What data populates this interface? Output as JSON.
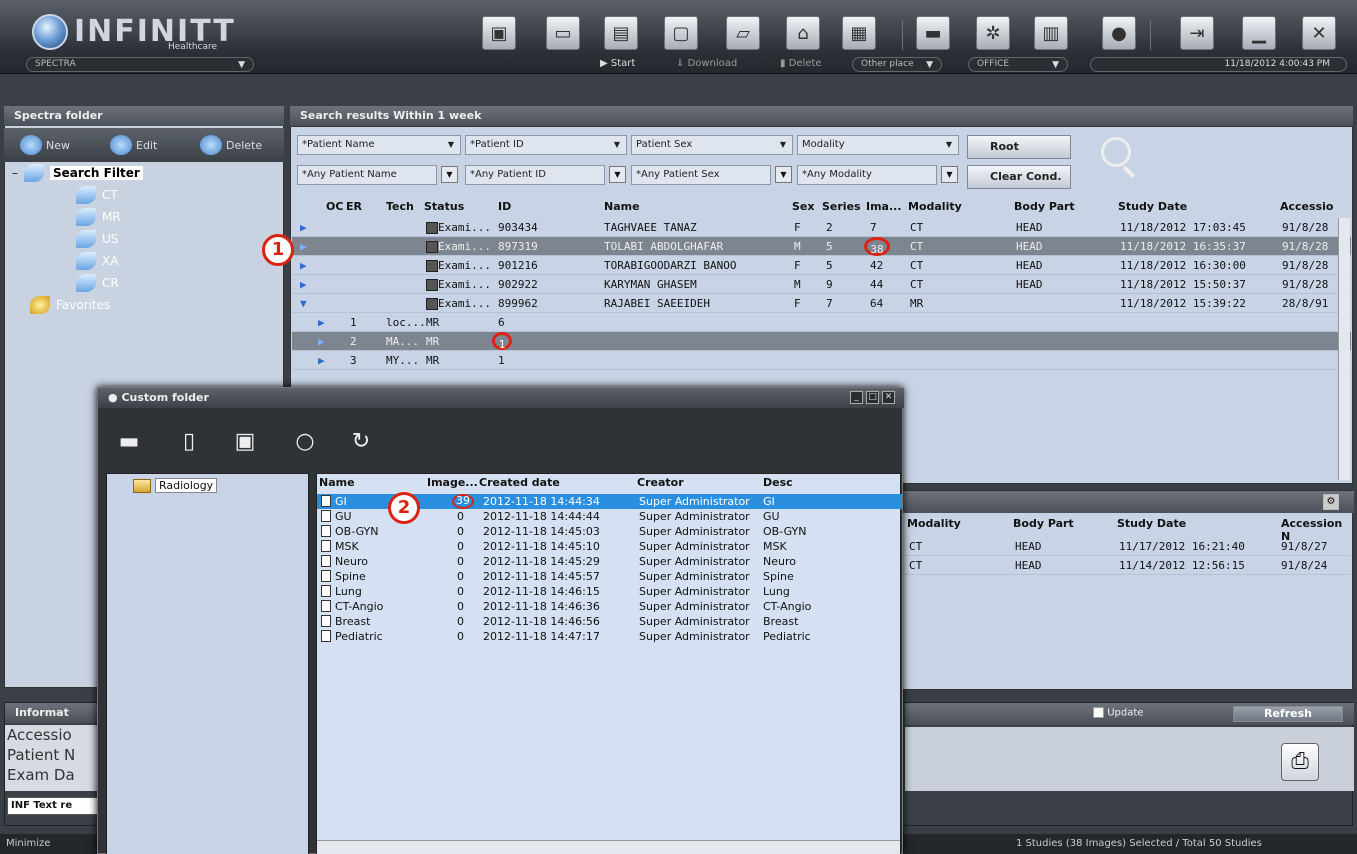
{
  "app": {
    "brand": "INFINITT",
    "brand_sub": "Healthcare",
    "mode": "SPECTRA"
  },
  "toolbar": {
    "start": "Start",
    "download": "Download",
    "delete": "Delete",
    "place": "Other place",
    "office": "OFFICE",
    "clock": "11/18/2012 4:00:43 PM"
  },
  "left": {
    "title": "Spectra folder",
    "new": "New",
    "edit": "Edit",
    "delete": "Delete",
    "root": "Search Filter",
    "items": [
      "CT",
      "MR",
      "US",
      "XA",
      "CR"
    ],
    "favorites": "Favorites"
  },
  "results": {
    "title": "Search results  Within 1 week",
    "filters": [
      {
        "label": "*Patient Name",
        "value": "*Any Patient Name"
      },
      {
        "label": "*Patient ID",
        "value": "*Any Patient ID"
      },
      {
        "label": "Patient Sex",
        "value": "*Any Patient Sex"
      },
      {
        "label": "Modality",
        "value": "*Any Modality"
      }
    ],
    "root_btn": "Root",
    "clear_btn": "Clear Cond.",
    "columns": [
      "OC",
      "ER",
      "Tech",
      "Status",
      "ID",
      "Name",
      "Sex",
      "Series",
      "Ima...",
      "Modality",
      "Body Part",
      "Study Date",
      "Accessio"
    ],
    "rows": [
      {
        "status": "Exami...",
        "id": "903434",
        "name": "TAGHVAEE TANAZ",
        "sex": "F",
        "series": "2",
        "images": "7",
        "modality": "CT",
        "body": "HEAD",
        "date": "11/18/2012 17:03:45",
        "acc": "91/8/28"
      },
      {
        "status": "Exami...",
        "id": "897319",
        "name": "TOLABI ABDOLGHAFAR",
        "sex": "M",
        "series": "5",
        "images": "38",
        "modality": "CT",
        "body": "HEAD",
        "date": "11/18/2012 16:35:37",
        "acc": "91/8/28"
      },
      {
        "status": "Exami...",
        "id": "901216",
        "name": "TORABIGOODARZI BANOO",
        "sex": "F",
        "series": "5",
        "images": "42",
        "modality": "CT",
        "body": "HEAD",
        "date": "11/18/2012 16:30:00",
        "acc": "91/8/28"
      },
      {
        "status": "Exami...",
        "id": "902922",
        "name": "KARYMAN GHASEM",
        "sex": "M",
        "series": "9",
        "images": "44",
        "modality": "CT",
        "body": "HEAD",
        "date": "11/18/2012 15:50:37",
        "acc": "91/8/28"
      },
      {
        "status": "Exami...",
        "id": "899962",
        "name": "RAJABEI SAEEIDEH",
        "sex": "F",
        "series": "7",
        "images": "64",
        "modality": "MR",
        "body": "",
        "date": "11/18/2012 15:39:22",
        "acc": "28/8/91"
      }
    ],
    "subrows": [
      {
        "n": "1",
        "desc": "loc...",
        "mod": "MR",
        "count": "6"
      },
      {
        "n": "2",
        "desc": "MA...",
        "mod": "MR",
        "count": "1"
      },
      {
        "n": "3",
        "desc": "MY...",
        "mod": "MR",
        "count": "1"
      }
    ]
  },
  "lower": {
    "columns": [
      "Modality",
      "Body Part",
      "Study Date",
      "Accession N"
    ],
    "rows": [
      {
        "modality": "CT",
        "body": "HEAD",
        "date": "11/17/2012 16:21:40",
        "acc": "91/8/27"
      },
      {
        "modality": "CT",
        "body": "HEAD",
        "date": "11/14/2012 12:56:15",
        "acc": "91/8/24"
      }
    ]
  },
  "info": {
    "title": "Informat",
    "lines": [
      "Accessio",
      "Patient N",
      "Exam Da"
    ],
    "text_btn": "INF Text re",
    "update": "Update",
    "refresh": "Refresh"
  },
  "status": {
    "left": "Minimize",
    "right": "1 Studies (38 Images) Selected / Total 50 Studies"
  },
  "markers": {
    "one": "1",
    "two": "2"
  },
  "custom_folder": {
    "title": "Custom folder",
    "tree_root": "Radiology",
    "columns": [
      "Name",
      "Image...",
      "Created date",
      "Creator",
      "Desc"
    ],
    "rows": [
      {
        "name": "GI",
        "images": "39",
        "date": "2012-11-18 14:44:34",
        "creator": "Super Administrator",
        "desc": "GI"
      },
      {
        "name": "GU",
        "images": "0",
        "date": "2012-11-18 14:44:44",
        "creator": "Super Administrator",
        "desc": "GU"
      },
      {
        "name": "OB-GYN",
        "images": "0",
        "date": "2012-11-18 14:45:03",
        "creator": "Super Administrator",
        "desc": "OB-GYN"
      },
      {
        "name": "MSK",
        "images": "0",
        "date": "2012-11-18 14:45:10",
        "creator": "Super Administrator",
        "desc": "MSK"
      },
      {
        "name": "Neuro",
        "images": "0",
        "date": "2012-11-18 14:45:29",
        "creator": "Super Administrator",
        "desc": "Neuro"
      },
      {
        "name": "Spine",
        "images": "0",
        "date": "2012-11-18 14:45:57",
        "creator": "Super Administrator",
        "desc": "Spine"
      },
      {
        "name": "Lung",
        "images": "0",
        "date": "2012-11-18 14:46:15",
        "creator": "Super Administrator",
        "desc": "Lung"
      },
      {
        "name": "CT-Angio",
        "images": "0",
        "date": "2012-11-18 14:46:36",
        "creator": "Super Administrator",
        "desc": "CT-Angio"
      },
      {
        "name": "Breast",
        "images": "0",
        "date": "2012-11-18 14:46:56",
        "creator": "Super Administrator",
        "desc": "Breast"
      },
      {
        "name": "Pediatric",
        "images": "0",
        "date": "2012-11-18 14:47:17",
        "creator": "Super Administrator",
        "desc": "Pediatric"
      }
    ]
  }
}
